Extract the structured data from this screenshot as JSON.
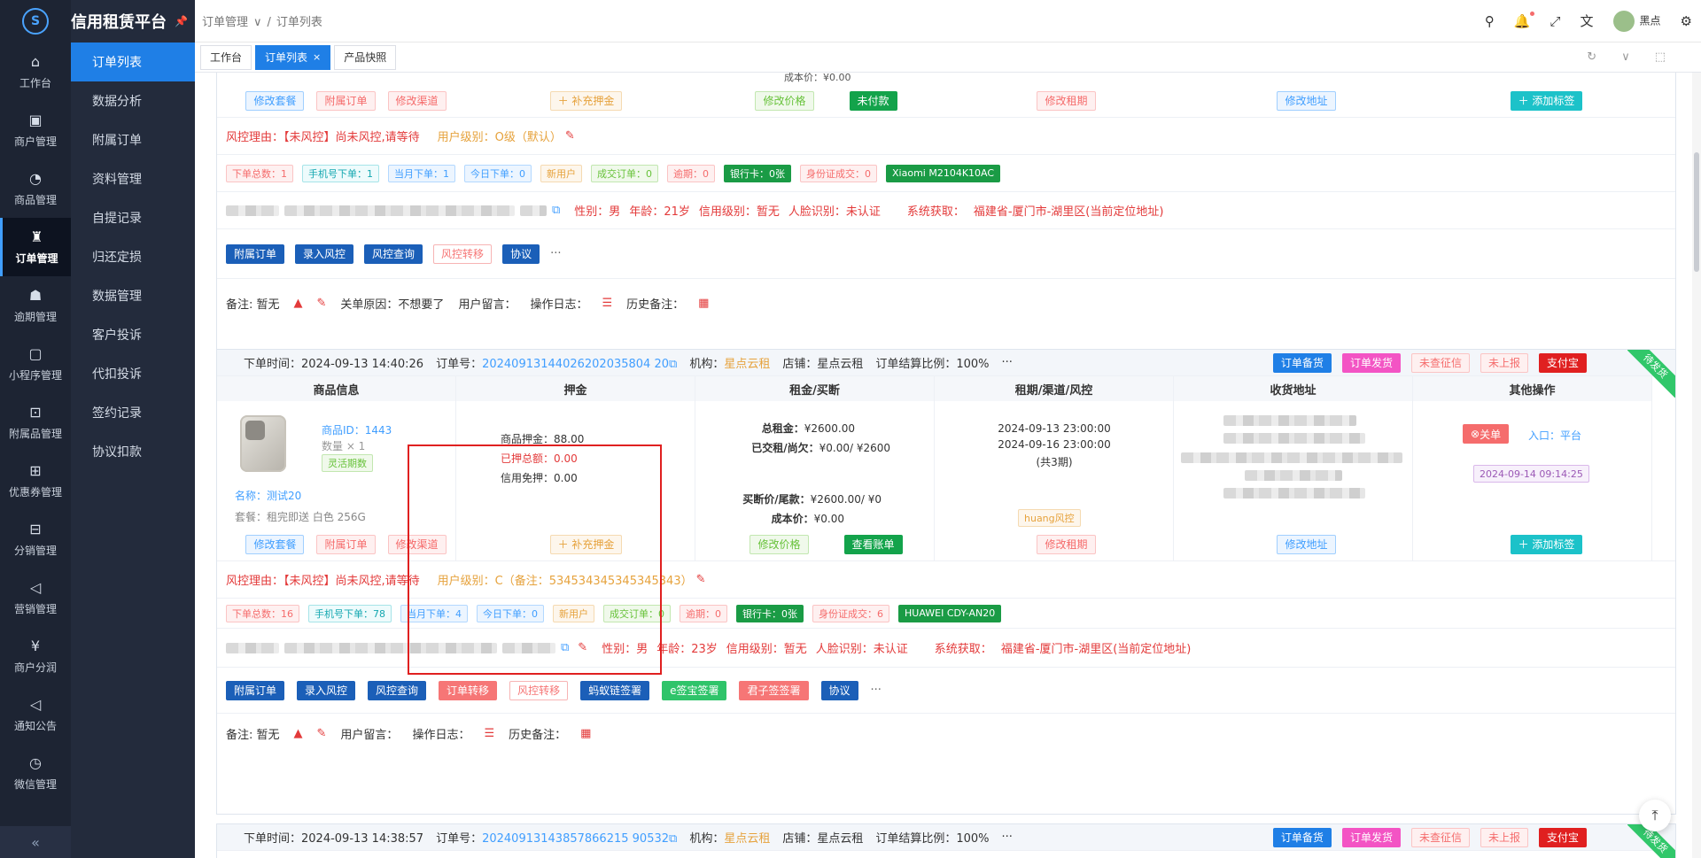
{
  "app": {
    "title": "信用租赁平台"
  },
  "sidebar": {
    "items": [
      {
        "label": "工作台",
        "icon": "⌂"
      },
      {
        "label": "商户管理",
        "icon": "▣"
      },
      {
        "label": "商品管理",
        "icon": "◔"
      },
      {
        "label": "订单管理",
        "icon": "♜"
      },
      {
        "label": "逾期管理",
        "icon": "☗"
      },
      {
        "label": "小程序管理",
        "icon": "▢"
      },
      {
        "label": "附属品管理",
        "icon": "⊡"
      },
      {
        "label": "优惠券管理",
        "icon": "⊞"
      },
      {
        "label": "分销管理",
        "icon": "⊟"
      },
      {
        "label": "营销管理",
        "icon": "◁"
      },
      {
        "label": "商户分润",
        "icon": "¥"
      },
      {
        "label": "通知公告",
        "icon": "◁"
      },
      {
        "label": "微信管理",
        "icon": "◷"
      }
    ],
    "collapse": "«"
  },
  "submenu": {
    "items": [
      "订单列表",
      "数据分析",
      "附属订单",
      "资料管理",
      "自提记录",
      "归还定损",
      "数据管理",
      "客户投诉",
      "代扣投诉",
      "签约记录",
      "协议扣款"
    ]
  },
  "header": {
    "breadcrumb": [
      "订单管理",
      "订单列表"
    ],
    "user": "黑点"
  },
  "tabs": [
    {
      "label": "工作台"
    },
    {
      "label": "订单列表"
    },
    {
      "label": "产品快照"
    }
  ],
  "top_partial": {
    "cost_label": "成本价：¥0.00",
    "buttons": [
      "修改套餐",
      "附属订单",
      "修改渠道",
      "＋ 补充押金",
      "修改价格",
      "未付款",
      "修改租期",
      "修改地址",
      "＋ 添加标签"
    ]
  },
  "order1": {
    "risk_reason": "风控理由：【未风控】尚未风控,请等待",
    "user_level": "用户级别：O级（默认）",
    "tags": [
      "下单总数：1",
      "手机号下单：1",
      "当月下单：1",
      "今日下单：0",
      "新用户",
      "成交订单：0",
      "逾期：0",
      "银行卡：0张",
      "身份证成交：0",
      "Xiaomi M2104K10AC"
    ],
    "info": {
      "gender": "性别：男",
      "age": "年龄：21岁",
      "credit": "信用级别：暂无",
      "face": "人脸识别：未认证",
      "sys": "系统获取：",
      "location": "福建省-厦门市-湖里区(当前定位地址)"
    },
    "actions": [
      "附属订单",
      "录入风控",
      "风控查询",
      "风控转移",
      "协议",
      "···"
    ],
    "remark": "备注: 暂无",
    "close_reason": "关单原因：不想要了",
    "message": "用户留言：",
    "oplog": "操作日志：",
    "history": "历史备注："
  },
  "order2": {
    "time": "下单时间：2024-09-13 14:40:26",
    "order_no_label": "订单号：",
    "order_no": "20240913144026202035804 20",
    "org_label": "机构：",
    "org": "星点云租",
    "shop": "店铺：星点云租",
    "settle": "订单结算比例：100%",
    "header_buttons": [
      "订单备货",
      "订单发货",
      "未查征信",
      "未上报",
      "支付宝"
    ],
    "corner": "待发货",
    "columns": [
      "商品信息",
      "押金",
      "租金/买断",
      "租期/渠道/风控",
      "收货地址",
      "其他操作"
    ],
    "goods": {
      "id": "商品ID：1443",
      "qty": "数量 × 1",
      "flex": "灵活期数",
      "name": "名称：测试20",
      "pkg": "套餐：租完即送 白色 256G"
    },
    "deposit": {
      "goods": "商品押金：88.00",
      "paid": "已押总额：0.00",
      "free": "信用免押：0.00"
    },
    "rent": {
      "total_label": "总租金：",
      "total": "¥2600.00",
      "paid_label": "已交租/尚欠：",
      "paid": "¥0.00/ ¥2600",
      "buyout_label": "买断价/尾款：",
      "buyout": "¥2600.00/ ¥0",
      "cost_label": "成本价：",
      "cost": "¥0.00"
    },
    "term": {
      "start": "2024-09-13 23:00:00",
      "end": "2024-09-16 23:00:00",
      "periods": "(共3期)",
      "risk": "huang风控"
    },
    "other": {
      "close": "关单",
      "entry": "入口：平台",
      "date": "2024-09-14 09:14:25"
    },
    "row_buttons": [
      "修改套餐",
      "附属订单",
      "修改渠道",
      "＋ 补充押金",
      "修改价格",
      "查看账单",
      "修改租期",
      "修改地址",
      "＋ 添加标签"
    ],
    "risk_reason": "风控理由：【未风控】尚未风控,请等待",
    "user_level": "用户级别：C（备注：534534345345345343）",
    "tags": [
      "下单总数：16",
      "手机号下单：78",
      "当月下单：4",
      "今日下单：0",
      "新用户",
      "成交订单：0",
      "逾期：0",
      "银行卡：0张",
      "身份证成交：6",
      "HUAWEI CDY-AN20"
    ],
    "info": {
      "gender": "性别：男",
      "age": "年龄：23岁",
      "credit": "信用级别：暂无",
      "face": "人脸识别：未认证",
      "sys": "系统获取：",
      "location": "福建省-厦门市-湖里区(当前定位地址)"
    },
    "actions": [
      "附属订单",
      "录入风控",
      "风控查询",
      "订单转移",
      "风控转移",
      "蚂蚁链签署",
      "e签宝签署",
      "君子签签署",
      "协议",
      "···"
    ],
    "remark": "备注: 暂无",
    "message": "用户留言：",
    "oplog": "操作日志：",
    "history": "历史备注："
  },
  "order3": {
    "time": "下单时间：2024-09-13 14:38:57",
    "order_no_label": "订单号：",
    "order_no": "20240913143857866215 90532",
    "org_label": "机构：",
    "org": "星点云租",
    "shop": "店铺：星点云租",
    "settle": "订单结算比例：100%",
    "header_buttons": [
      "订单备货",
      "订单发货",
      "未查征信",
      "未上报",
      "支付宝"
    ],
    "corner": "待发货"
  }
}
